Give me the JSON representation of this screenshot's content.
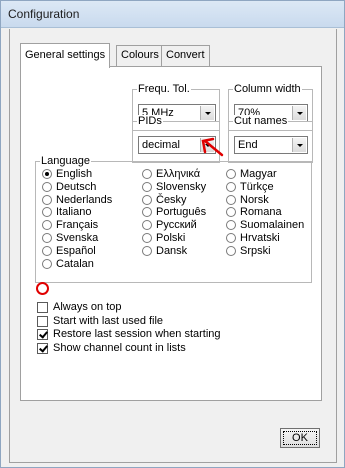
{
  "window": {
    "title": "Configuration"
  },
  "tabs": [
    {
      "label": "General settings"
    },
    {
      "label": "Colours"
    },
    {
      "label": "Convert"
    }
  ],
  "frequ_tol": {
    "label": "Frequ. Tol.",
    "value": "5 MHz"
  },
  "column_width": {
    "label": "Column width",
    "value": "70%"
  },
  "pids": {
    "label": "PIDs",
    "value": "decimal"
  },
  "cut_names": {
    "label": "Cut names",
    "value": "End"
  },
  "language": {
    "label": "Language",
    "selected": "English",
    "col1": [
      "English",
      "Deutsch",
      "Nederlands",
      "Italiano",
      "Français",
      "Svenska",
      "Español",
      "Catalan"
    ],
    "col2": [
      "Ελληνικά",
      "Slovensky",
      "Česky",
      "Português",
      "Русский",
      "Polski",
      "Dansk"
    ],
    "col3": [
      "Magyar",
      "Türkçe",
      "Norsk",
      "Romana",
      "Suomalainen",
      "Hrvatski",
      "Srpski"
    ]
  },
  "options": [
    {
      "label": "Always on top",
      "checked": false
    },
    {
      "label": "Start with last used file",
      "checked": false
    },
    {
      "label": "Restore last session when starting",
      "checked": true
    },
    {
      "label": "Show channel count in lists",
      "checked": true
    }
  ],
  "ok_button": {
    "label": "OK"
  },
  "annotation": {
    "color": "#e00000"
  }
}
